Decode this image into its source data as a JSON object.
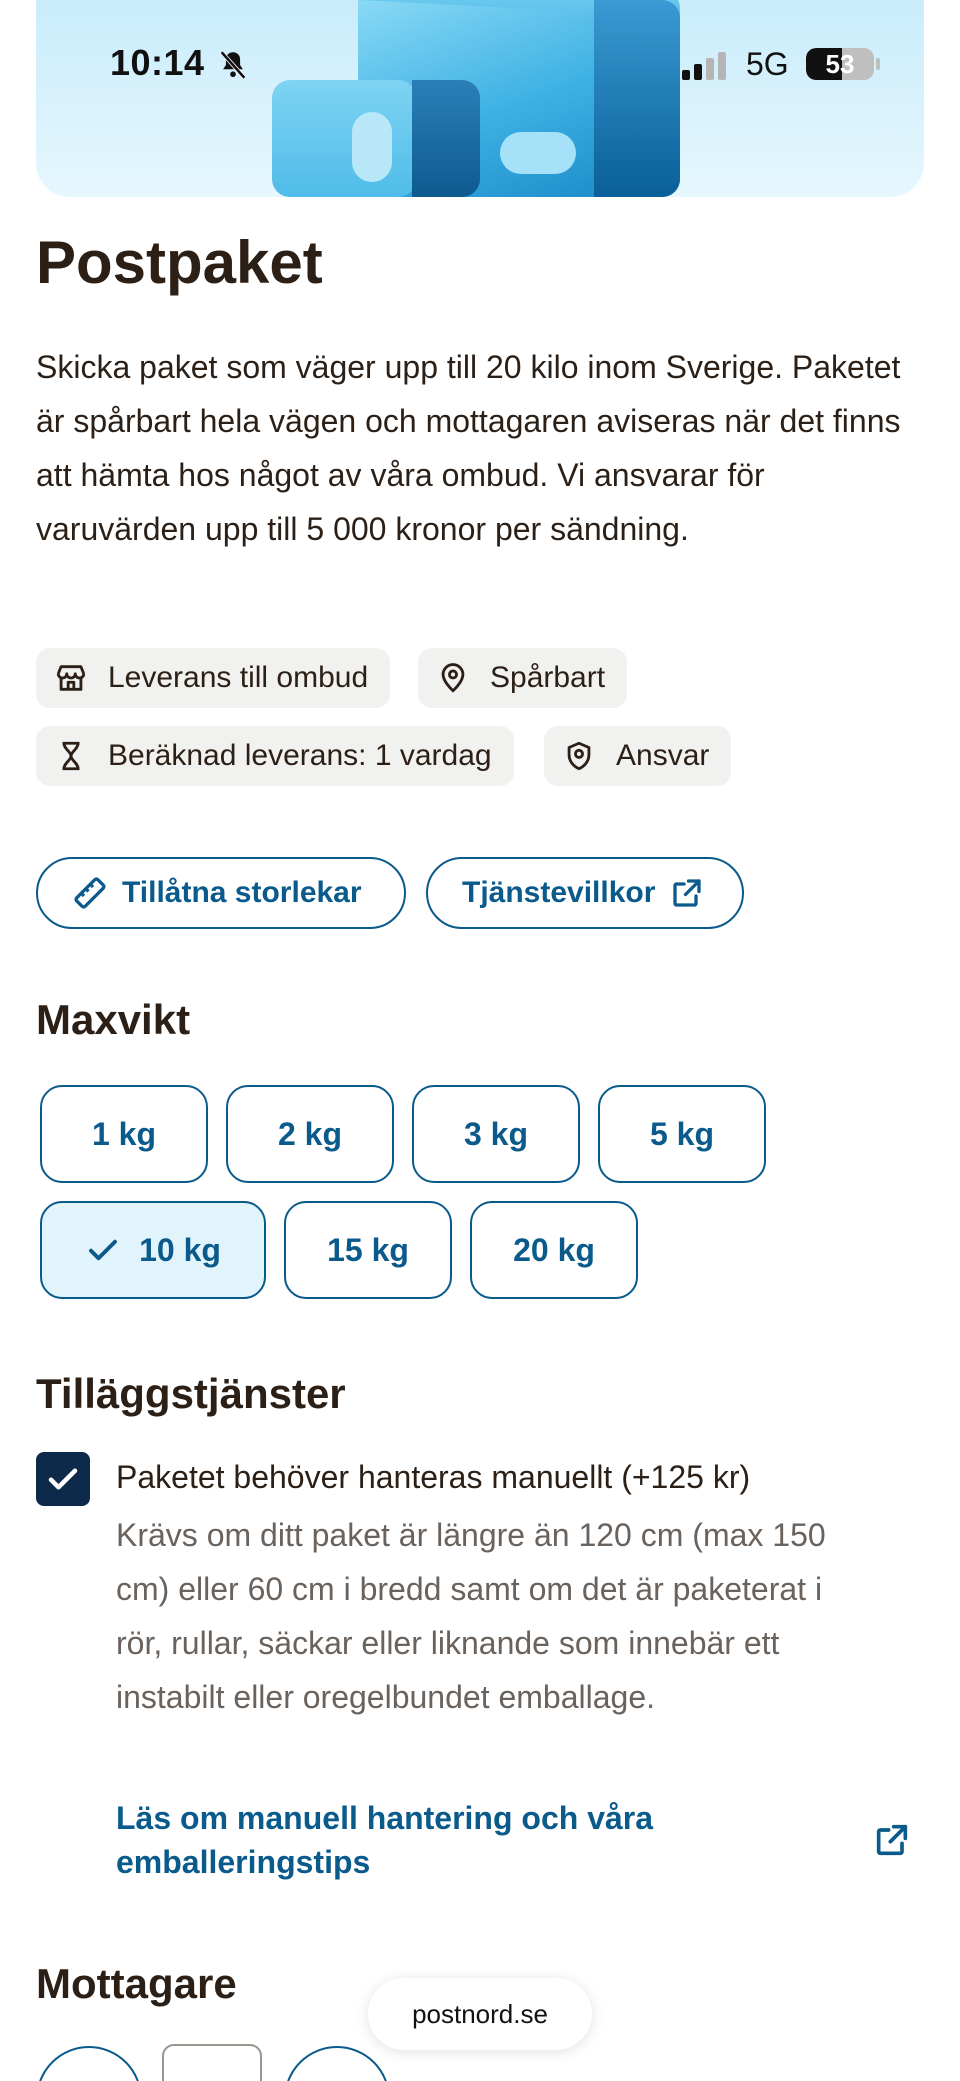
{
  "status_bar": {
    "time": "10:14",
    "network": "5G",
    "battery": "53",
    "battery_level": 0.53
  },
  "hero": {
    "icon": "parcel-illustration"
  },
  "product": {
    "title": "Postpaket",
    "description": "Skicka paket som väger upp till 20 kilo inom Sverige. Paketet är spårbart hela vägen och mottagaren aviseras när det finns att hämta hos något av våra ombud. Vi ansvarar för varuvärden upp till 5 000 kronor per sändning."
  },
  "features": [
    {
      "icon": "store-icon",
      "label": "Leverans till ombud"
    },
    {
      "icon": "location-pin-icon",
      "label": "Spårbart"
    },
    {
      "icon": "hourglass-icon",
      "label": "Beräknad leverans: 1 vardag"
    },
    {
      "icon": "shield-pin-icon",
      "label": "Ansvar"
    }
  ],
  "actions": {
    "sizes_label": "Tillåtna storlekar",
    "terms_label": "Tjänstevillkor"
  },
  "max_weight": {
    "title": "Maxvikt",
    "options": [
      "1 kg",
      "2 kg",
      "3 kg",
      "5 kg",
      "10 kg",
      "15 kg",
      "20 kg"
    ],
    "selected": "10 kg"
  },
  "addons": {
    "title": "Tilläggstjänster",
    "items": [
      {
        "checked": true,
        "label": "Paketet behöver hanteras manuellt (+125 kr)",
        "description": "Krävs om ditt paket är längre än 120 cm (max 150 cm) eller 60 cm i bredd samt om det är paketerat i rör, rullar, säckar eller liknande som innebär ett instabilt eller oregelbundet emballage.",
        "link": "Läs om manuell hantering och våra emballeringstips"
      }
    ]
  },
  "recipients": {
    "title": "Mottagare"
  },
  "browser": {
    "url": "postnord.se"
  },
  "colors": {
    "brand_blue": "#0a5a8c",
    "text": "#2b1f16",
    "selected_bg": "#e1f4fc",
    "checkbox": "#0d2a4a",
    "chip_bg": "#f1f1f0"
  }
}
